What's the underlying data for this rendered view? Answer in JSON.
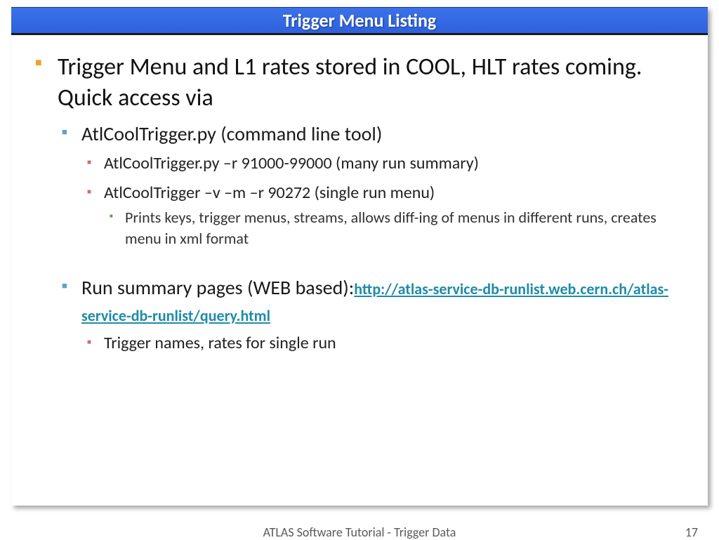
{
  "title": "Trigger Menu Listing",
  "bullets": {
    "main": "Trigger Menu and L1 rates stored in COOL, HLT rates coming. Quick access via",
    "sub1": "AtlCoolTrigger.py (command line tool)",
    "sub1a": "AtlCoolTrigger.py –r 91000-99000 (many run summary)",
    "sub1b": "AtlCoolTrigger –v –m –r 90272 (single run menu)",
    "sub1b1": "Prints keys, trigger menus, streams, allows diff-ing of menus in different runs, creates menu in xml format",
    "sub2_prefix": "Run summary pages (WEB based):",
    "sub2_link": "http://atlas-service-db-runlist.web.cern.ch/atlas-service-db-runlist/query.html",
    "sub2a": "Trigger names, rates for single run"
  },
  "footer": {
    "center": "ATLAS Software Tutorial - Trigger Data",
    "page": "17"
  }
}
